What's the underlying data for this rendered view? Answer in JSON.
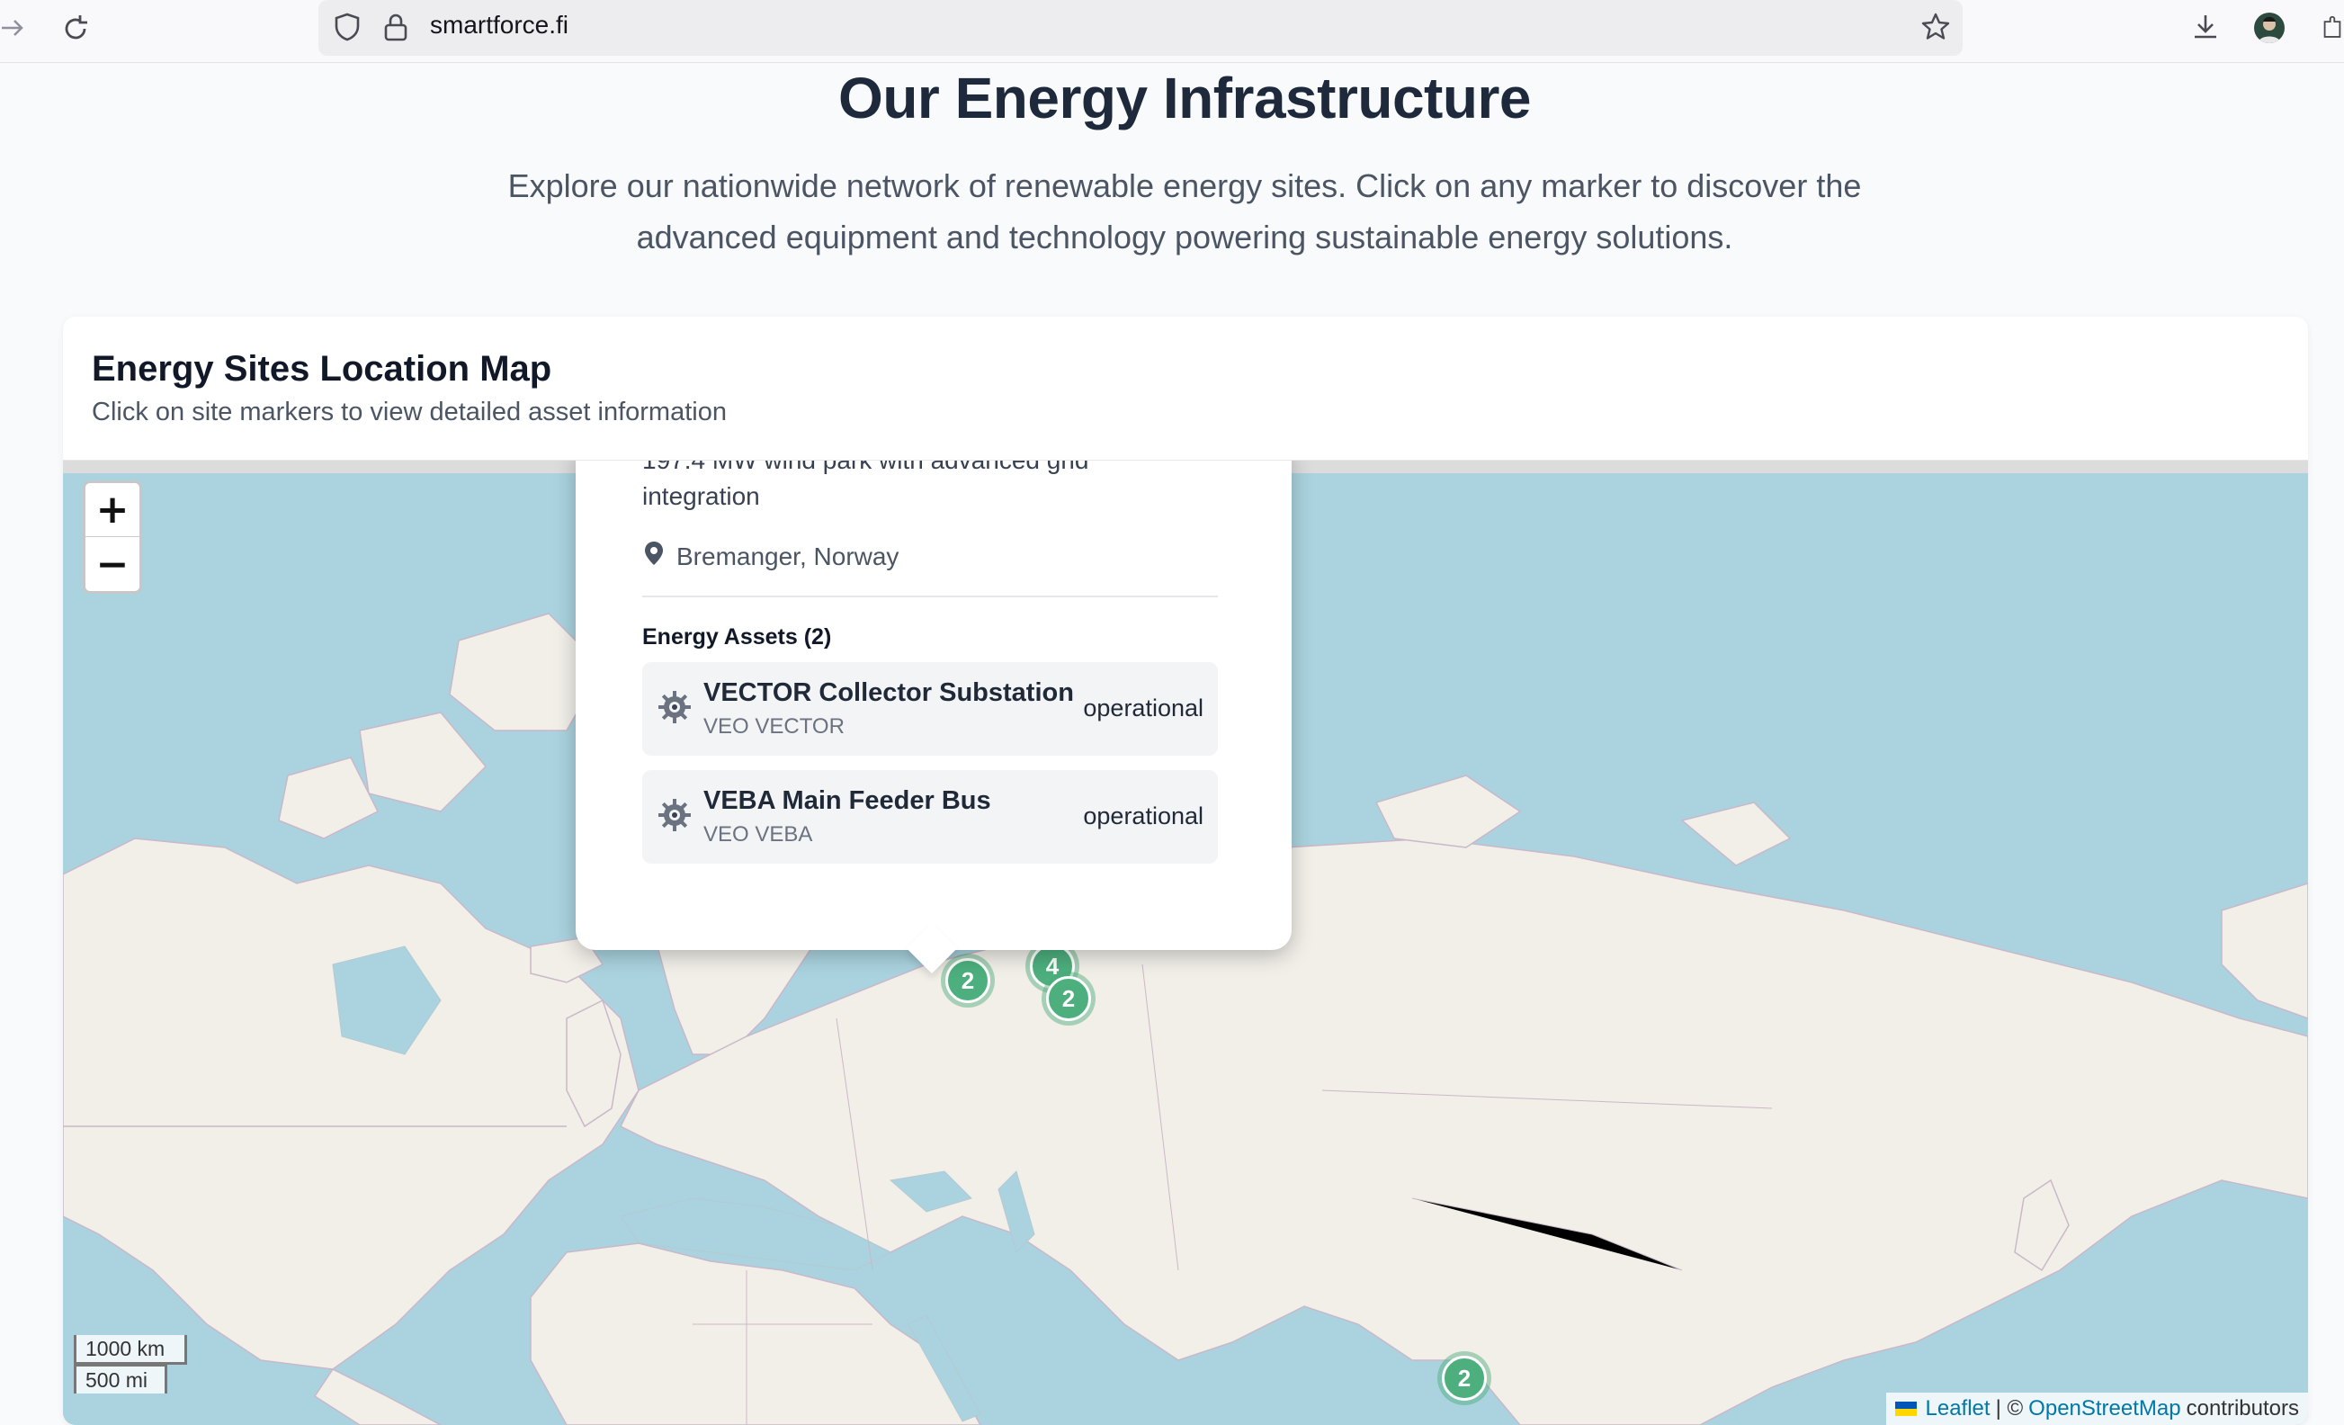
{
  "browser": {
    "url": "smartforce.fi",
    "icons": [
      "forward-icon",
      "reload-icon",
      "shield-icon",
      "lock-icon",
      "bookmark-star-icon",
      "download-icon",
      "profile-avatar",
      "extensions-icon"
    ]
  },
  "hero": {
    "title": "Our Energy Infrastructure",
    "subtitle_line1": "Explore our nationwide network of renewable energy sites. Click on any marker to discover the",
    "subtitle_line2": "advanced equipment and technology powering sustainable energy solutions."
  },
  "map_card": {
    "title": "Energy Sites Location Map",
    "subtitle": "Click on site markers to view detailed asset information"
  },
  "map": {
    "zoom_in": "+",
    "zoom_out": "−",
    "scale_km": "1000 km",
    "scale_mi": "500 mi",
    "attribution": {
      "leaflet": "Leaflet",
      "separator": "| ©",
      "osm": "OpenStreetMap",
      "contributors": "contributors"
    },
    "clusters": [
      {
        "count": "2"
      },
      {
        "count": "4"
      },
      {
        "count": "2"
      },
      {
        "count": "2"
      }
    ],
    "colors": {
      "water": "#aad3df",
      "land": "#f2efe9",
      "cluster": "#4caf7d"
    }
  },
  "popup": {
    "description_line1": "197.4 MW wind park with advanced grid",
    "description_line2": "integration",
    "location": "Bremanger, Norway",
    "assets_title": "Energy Assets (2)",
    "assets": [
      {
        "name": "VECTOR Collector Substation",
        "code": "VEO VECTOR",
        "status": "operational"
      },
      {
        "name": "VEBA Main Feeder Bus",
        "code": "VEO VEBA",
        "status": "operational"
      }
    ]
  }
}
